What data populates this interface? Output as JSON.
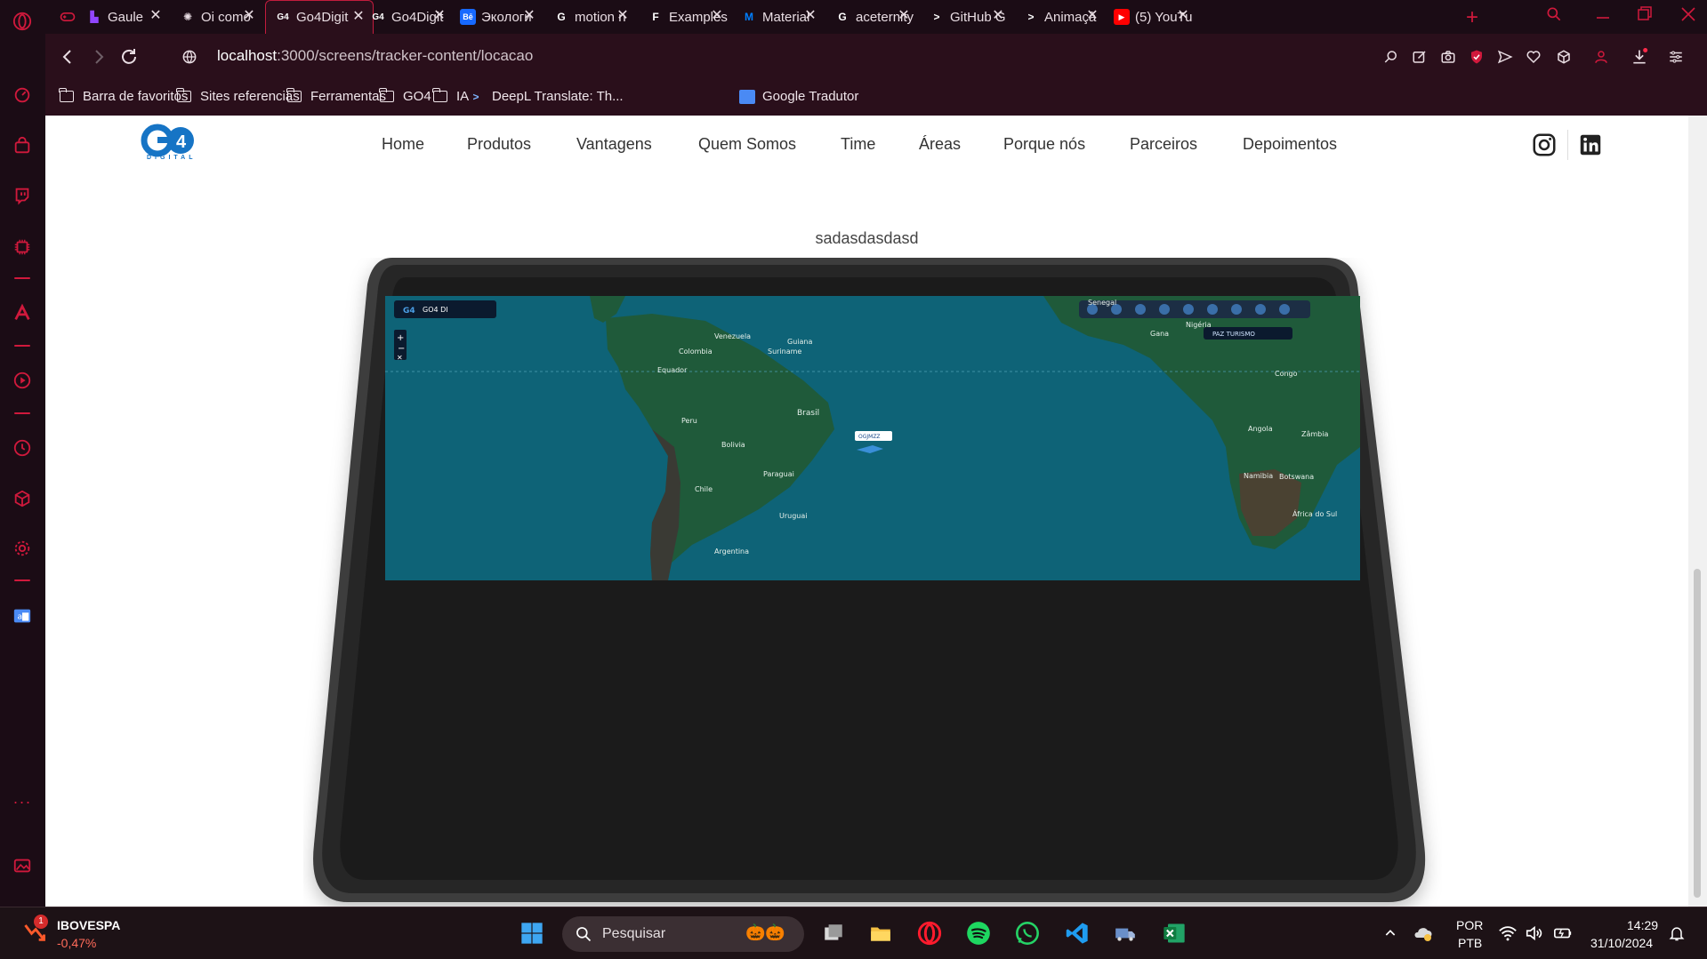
{
  "browser": {
    "tabs": [
      {
        "title": "Gaule",
        "favicon": "twitch-icon",
        "color": "#9146ff"
      },
      {
        "title": "Oi como",
        "favicon": "openai-icon",
        "color": "#e9dde3"
      },
      {
        "title": "Go4Digit",
        "favicon": "go4-icon",
        "color": "#ffffff",
        "active": true
      },
      {
        "title": "Go4Digit",
        "favicon": "go4-icon",
        "color": "#ffffff"
      },
      {
        "title": "Экологи",
        "favicon": "behance-icon",
        "color": "#1769ff"
      },
      {
        "title": "motion n",
        "favicon": "google-icon",
        "color": "#ffffff"
      },
      {
        "title": "Examples",
        "favicon": "framer-icon",
        "color": "#ffffff"
      },
      {
        "title": "Material",
        "favicon": "mui-icon",
        "color": "#007fff"
      },
      {
        "title": "aceternity",
        "favicon": "google-icon",
        "color": "#ffffff"
      },
      {
        "title": "GitHub G",
        "favicon": "prompt-icon",
        "color": "#ffffff"
      },
      {
        "title": "Animaçã",
        "favicon": "prompt-icon",
        "color": "#ffffff"
      },
      {
        "title": "(5) YouTu",
        "favicon": "youtube-icon",
        "color": "#ff0000"
      }
    ],
    "url_host": "localhost",
    "url_path": ":3000/screens/tracker-content/locacao",
    "bookmarks": [
      {
        "label": "Barra de favoritos",
        "icon": "folder-icon"
      },
      {
        "label": "Sites referencias",
        "icon": "folder-icon"
      },
      {
        "label": "Ferramentas",
        "icon": "folder-icon"
      },
      {
        "label": "GO4",
        "icon": "folder-icon"
      },
      {
        "label": "IA",
        "icon": "folder-icon"
      },
      {
        "label": "DeepL Translate: Th...",
        "icon": "deepl-icon"
      },
      {
        "label": "Google Tradutor",
        "icon": "google-translate-icon"
      }
    ]
  },
  "site": {
    "logo_text": "G4",
    "logo_sub": "DIGITAL",
    "nav": [
      "Home",
      "Produtos",
      "Vantagens",
      "Quem Somos",
      "Time",
      "Áreas",
      "Porque nós",
      "Parceiros",
      "Depoimentos"
    ],
    "caption": "sadasdasdasd",
    "map": {
      "brand": "GO4 DI",
      "badge": "PAZ TURISMO",
      "marker": "OGJMZZ",
      "labels": [
        "Brasil",
        "Peru",
        "Bolivia",
        "Paraguai",
        "Chile",
        "Argentina",
        "Uruguai",
        "Venezuela",
        "Colombia",
        "Equador",
        "Guiana",
        "Suriname",
        "Angola",
        "Namibia",
        "Zâmbia",
        "Botswana",
        "África do Sul",
        "Congo",
        "Nigéria",
        "Gana",
        "Senegal"
      ]
    }
  },
  "taskbar": {
    "stock_name": "IBOVESPA",
    "stock_change": "-0,47%",
    "stock_badge": "1",
    "search_placeholder": "Pesquisar",
    "lang_1": "POR",
    "lang_2": "PTB",
    "time": "14:29",
    "date": "31/10/2024"
  },
  "colors": {
    "accent": "#d0193c",
    "map_ocean": "#0e6377",
    "map_land": "#1f5a3a",
    "tablet_bezel": "#2b2b2b"
  }
}
